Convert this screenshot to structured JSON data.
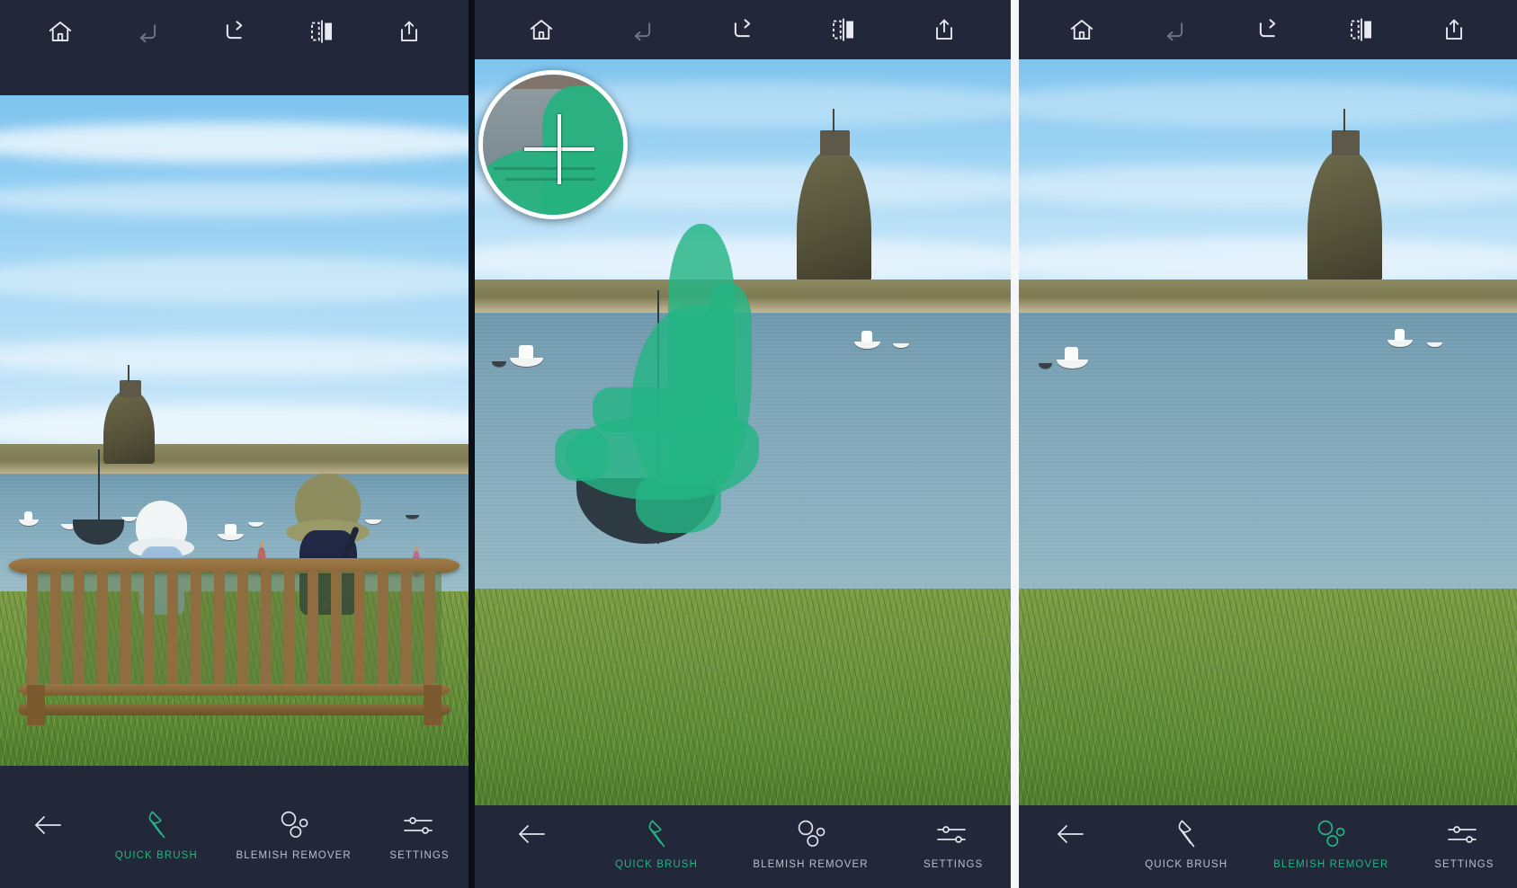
{
  "app": {
    "accent_green": "#24b484",
    "toolbar_bg": "#222739",
    "mask_color": "#24b484",
    "divider_light": "#f4f6f8"
  },
  "top_toolbar": {
    "items": [
      {
        "name": "home-icon",
        "label": "Home"
      },
      {
        "name": "undo-icon",
        "label": "Undo"
      },
      {
        "name": "redo-icon",
        "label": "Redo"
      },
      {
        "name": "compare-icon",
        "label": "Compare"
      },
      {
        "name": "share-icon",
        "label": "Share"
      }
    ]
  },
  "bottom_toolbar": {
    "back_label": "Back",
    "tools": [
      {
        "label": "QUICK BRUSH",
        "icon": "brush-icon"
      },
      {
        "label": "BLEMISH REMOVER",
        "icon": "blemish-icon"
      },
      {
        "label": "SETTINGS",
        "icon": "sliders-icon"
      }
    ]
  },
  "panels": [
    {
      "id": "panel-original",
      "active_tool": "QUICK BRUSH",
      "photo_caption": "Couple on a wooden bench looking out over Lindisfarne Castle and the harbour",
      "has_loupe": false,
      "has_mask": false
    },
    {
      "id": "panel-masking",
      "active_tool": "QUICK BRUSH",
      "photo_caption": "Zoomed harbour view with sailboat painted over by the green selection mask",
      "has_loupe": true,
      "has_mask": true,
      "loupe_cursor": "crosshair-cursor"
    },
    {
      "id": "panel-result",
      "active_tool": "BLEMISH REMOVER",
      "photo_caption": "Harbour view after the sailboat has been removed",
      "has_loupe": false,
      "has_mask": false
    }
  ]
}
